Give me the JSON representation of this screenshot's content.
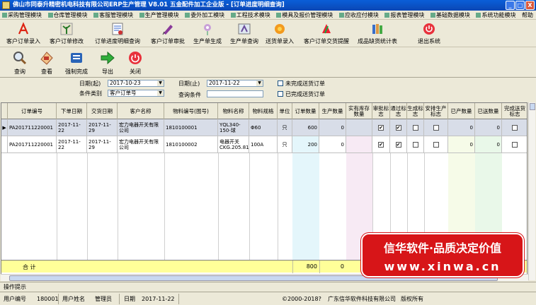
{
  "window": {
    "title": "佛山市同泰升精密机电科技有限公司ERP生产管理  V8.01 五金配件加工企业版 - [订单进度明细查询]",
    "minimize": "_",
    "maximize": "□",
    "close": "X"
  },
  "menu": [
    "采购管理模块",
    "仓库管理模块",
    "客服管理模块",
    "生产管理模块",
    "委外加工模块",
    "工程技术模块",
    "模具及报价管理模块",
    "应收应付模块",
    "报表管理模块",
    "基础数据模块",
    "系统功能模块",
    "帮助"
  ],
  "toolbar1": [
    {
      "label": "客户订单录入",
      "icon": "pdf-icon"
    },
    {
      "label": "客户订单修改",
      "icon": "plant-icon"
    },
    {
      "label": "订单进度明细查询",
      "icon": "document-icon"
    },
    {
      "label": "客户订单审批",
      "icon": "pen-icon"
    },
    {
      "label": "生产单生成",
      "icon": "orchid-icon"
    },
    {
      "label": "生产单查询",
      "icon": "image-icon"
    },
    {
      "label": "送货单录入",
      "icon": "flower-icon"
    },
    {
      "label": "客户订单交货提醒",
      "icon": "bell-icon"
    },
    {
      "label": "成品缺货统计表",
      "icon": "books-icon"
    },
    {
      "label": "退出系统",
      "icon": "power-icon"
    }
  ],
  "toolbar2": [
    {
      "label": "查询",
      "icon": "magnifier-icon"
    },
    {
      "label": "查看",
      "icon": "view-icon"
    },
    {
      "label": "强制完成",
      "icon": "stamp-icon"
    },
    {
      "label": "导出",
      "icon": "arrow-right-icon"
    },
    {
      "label": "关闭",
      "icon": "close-circle-icon"
    }
  ],
  "filter": {
    "date_from_label": "日期(起)",
    "date_from": "2017-10-23",
    "date_to_label": "日期(止)",
    "date_to": "2017-11-22",
    "category_label": "条件类别",
    "category": "客户订单号",
    "query_label": "查询条件",
    "query_value": "",
    "chk_unfinished_label": "未完成送货订单",
    "chk_finished_label": "已完成送货订单"
  },
  "table": {
    "columns": [
      "订单编号",
      "下单日期",
      "交货日期",
      "客户名称",
      "物料编号(图号)",
      "物料名称",
      "物料规格",
      "单位",
      "订单数量",
      "生产数量",
      "实有库存数量",
      "审批标志",
      "通过标志",
      "生成标志",
      "安排生产标志",
      "已产数量",
      "已送数量",
      "完成送货标志"
    ],
    "rows": [
      {
        "order_no": "PA201711220001",
        "order_date": "2017-11-22",
        "delivery_date": "2017-11-29",
        "customer": "宏力电器开关有限公司",
        "material_no": "1810100001",
        "material_name": "YQL340-150-球",
        "spec": "Φ60",
        "unit": "只",
        "order_qty": "600",
        "prod_qty": "0",
        "stock": "",
        "approve": "✔",
        "pass": "✔",
        "generate": "",
        "arrange": "",
        "produced": "0",
        "delivered": "0",
        "done": ""
      },
      {
        "order_no": "PA201711220001",
        "order_date": "2017-11-22",
        "delivery_date": "2017-11-29",
        "customer": "宏力电器开关有限公司",
        "material_no": "1810100002",
        "material_name": "电器开关 CKG.205.816",
        "spec": "100A",
        "unit": "只",
        "order_qty": "200",
        "prod_qty": "0",
        "stock": "",
        "approve": "✔",
        "pass": "✔",
        "generate": "",
        "arrange": "",
        "produced": "0",
        "delivered": "0",
        "done": ""
      }
    ],
    "total_label": "合 计",
    "total_order_qty": "800",
    "total_prod_qty": "0"
  },
  "tip_bar": "操作提示",
  "status": {
    "user_no_label": "用户编号",
    "user_no": "180001",
    "user_name_label": "用户姓名",
    "user_name": "管理员",
    "date_label": "日期",
    "date": "2017-11-22",
    "copyright": "©2000-2018?",
    "company": "广东信华软件科技有限公司",
    "rights": "版权所有"
  },
  "promo": {
    "line1": "信华软件·品质决定价值",
    "line2": "www.xinwa.cn"
  },
  "colors": {
    "titlebar": "#0b4fc8",
    "promo": "#d71518",
    "total_row": "#ffff99"
  }
}
